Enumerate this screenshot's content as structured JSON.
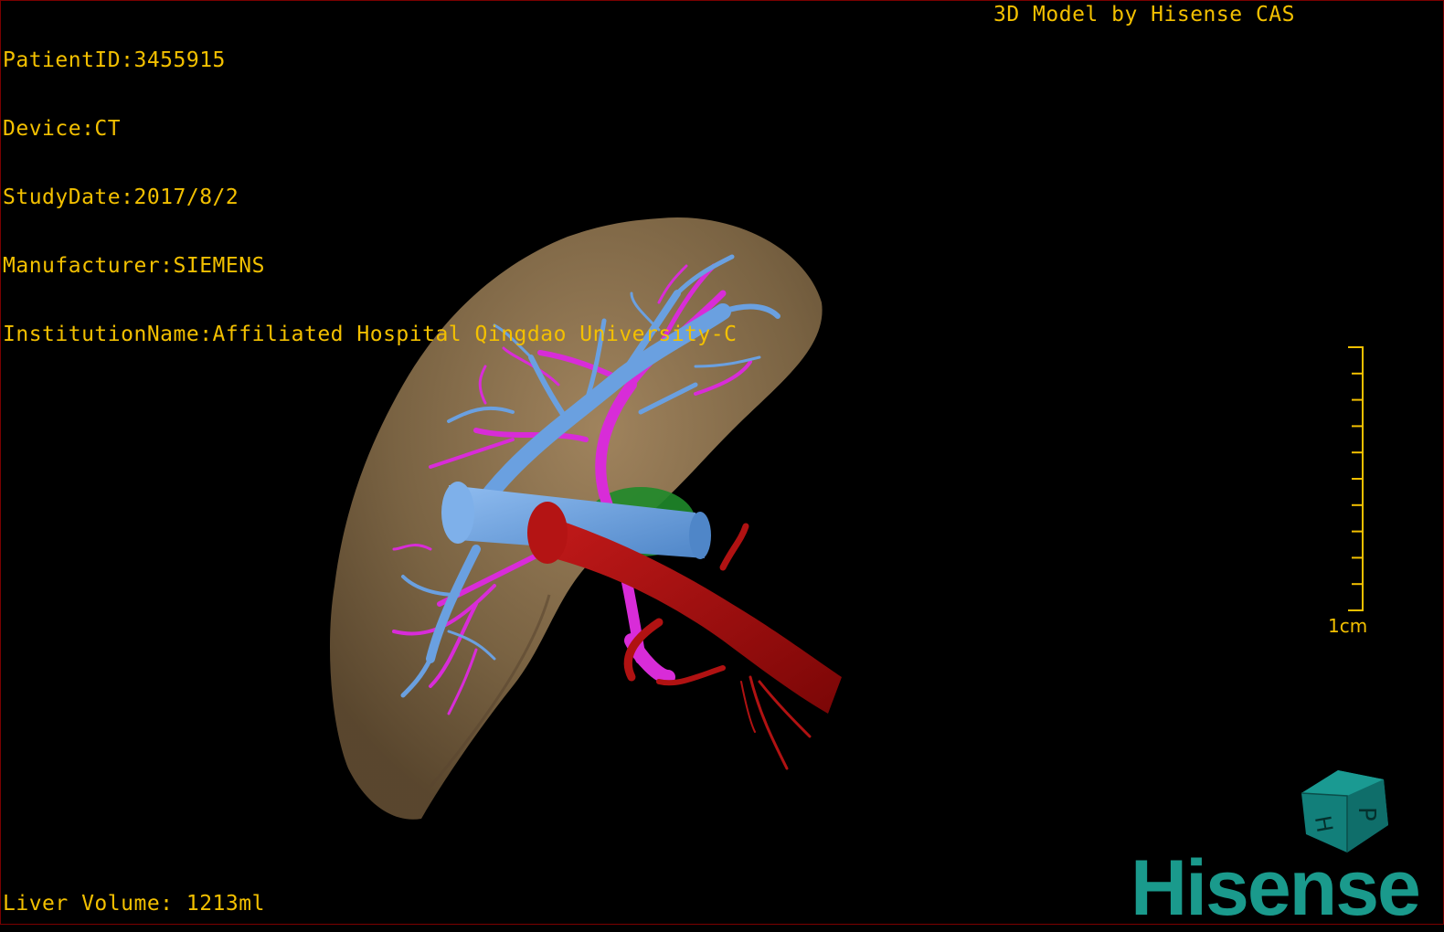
{
  "info": {
    "patient_id": "PatientID:3455915",
    "device": "Device:CT",
    "study_date": "StudyDate:2017/8/2",
    "manufacturer": "Manufacturer:SIEMENS",
    "institution": "InstitutionName:Affiliated Hospital Qingdao University-C"
  },
  "brand_caption": "3D Model by Hisense CAS",
  "liver_volume": "Liver Volume: 1213ml",
  "scale": {
    "label": "1cm",
    "ticks": 10
  },
  "orientation_cube": {
    "faces": [
      "P",
      "H"
    ],
    "color": "#127f7a"
  },
  "logo": {
    "text": "Hisense",
    "color": "#1a9a8c"
  },
  "colors": {
    "overlay_text": "#f3c000",
    "liver": "#7a6040",
    "portal_vein": "#6aa0e0",
    "hepatic_artery": "#d82cd8",
    "aorta": "#a80c0c",
    "gallbladder": "#1f8a2a",
    "frame": "#7a0000"
  }
}
